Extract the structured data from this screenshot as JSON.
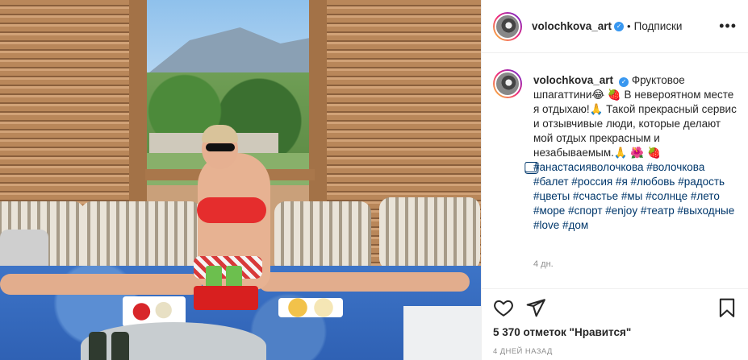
{
  "post": {
    "username": "volochkova_art",
    "follow_state": "Подписки",
    "more_label": "•••",
    "caption_text": "Фруктовое шпагаттини😂 🍓 В невероятном месте я отдыхаю!🙏 Такой прекрасный сервис и отзывчивые люди, которые делают мой отдых прекрасным и незабываемым.🙏 🌺 🍓 ",
    "hashtags": "⃣#анастасияволочкова #волочкова #балет #россия #я #любовь #радость #цветы #счастье #мы #солнце #лето #море #спорт #enjoy #театр #выходные #love #дом",
    "caption_age": "4 дн.",
    "likes_text": "5 370 отметок \"Нравится\"",
    "date_text": "4 ДНЕЙ НАЗАД"
  },
  "colors": {
    "link": "#00376b",
    "verified": "#3897f0",
    "meta": "#8e8e8e"
  },
  "icons": [
    "heart-icon",
    "share-icon",
    "bookmark-icon",
    "more-icon",
    "verified-badge-icon"
  ]
}
